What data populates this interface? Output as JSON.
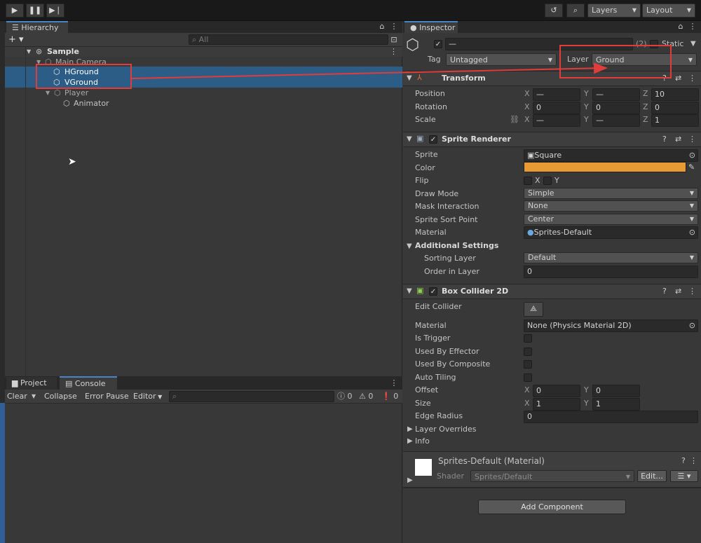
{
  "toolbar": {
    "play_icon": "play-icon",
    "pause_icon": "pause-icon",
    "step_icon": "step-icon",
    "layers_label": "Layers",
    "layout_label": "Layout"
  },
  "hierarchy": {
    "tab_label": "Hierarchy",
    "search_placeholder": "All",
    "scene_name": "Sample",
    "items": [
      {
        "name": "Main Camera"
      },
      {
        "name": "HGround"
      },
      {
        "name": "VGround"
      },
      {
        "name": "Player"
      },
      {
        "name": "Animator"
      }
    ]
  },
  "bottom": {
    "tab_project": "Project",
    "tab_console": "Console",
    "clear": "Clear",
    "collapse": "Collapse",
    "error_pause": "Error Pause",
    "editor": "Editor",
    "count_logs": "0",
    "count_warnings": "0",
    "count_errors": "0"
  },
  "inspector": {
    "tab_label": "Inspector",
    "object_name": "—",
    "count": "(2)",
    "static_label": "Static",
    "tag_label": "Tag",
    "tag_value": "Untagged",
    "layer_label": "Layer",
    "layer_value": "Ground",
    "transform": {
      "title": "Transform",
      "position_label": "Position",
      "rotation_label": "Rotation",
      "scale_label": "Scale",
      "position": {
        "x": "—",
        "y": "—",
        "z": "10"
      },
      "rotation": {
        "x": "0",
        "y": "0",
        "z": "0"
      },
      "scale": {
        "x": "—",
        "y": "—",
        "z": "1"
      }
    },
    "sprite_renderer": {
      "title": "Sprite Renderer",
      "sprite_label": "Sprite",
      "sprite_value": "Square",
      "color_label": "Color",
      "color_value": "#e89a35",
      "flip_label": "Flip",
      "flip_x": "X",
      "flip_y": "Y",
      "draw_mode_label": "Draw Mode",
      "draw_mode_value": "Simple",
      "mask_label": "Mask Interaction",
      "mask_value": "None",
      "sort_point_label": "Sprite Sort Point",
      "sort_point_value": "Center",
      "material_label": "Material",
      "material_value": "Sprites-Default",
      "additional_label": "Additional Settings",
      "sorting_layer_label": "Sorting Layer",
      "sorting_layer_value": "Default",
      "order_label": "Order in Layer",
      "order_value": "0"
    },
    "box_collider": {
      "title": "Box Collider 2D",
      "edit_collider_label": "Edit Collider",
      "material_label": "Material",
      "material_value": "None (Physics Material 2D)",
      "is_trigger_label": "Is Trigger",
      "used_by_effector_label": "Used By Effector",
      "used_by_composite_label": "Used By Composite",
      "auto_tiling_label": "Auto Tiling",
      "offset_label": "Offset",
      "offset_x": "0",
      "offset_y": "0",
      "size_label": "Size",
      "size_x": "1",
      "size_y": "1",
      "edge_radius_label": "Edge Radius",
      "edge_radius_value": "0",
      "layer_overrides_label": "Layer Overrides",
      "info_label": "Info"
    },
    "material_section": {
      "title": "Sprites-Default (Material)",
      "shader_label": "Shader",
      "shader_value": "Sprites/Default",
      "edit_label": "Edit..."
    },
    "add_component_label": "Add Component"
  }
}
